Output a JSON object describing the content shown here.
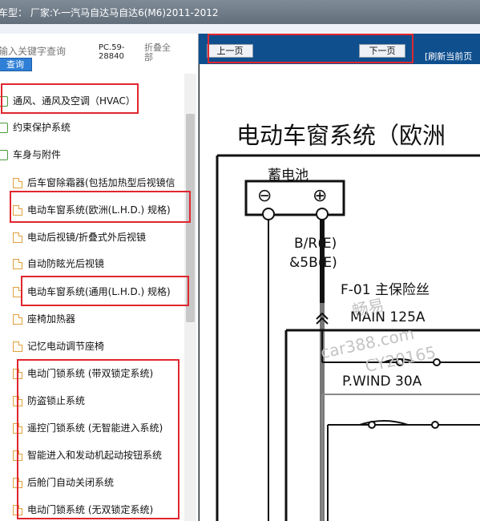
{
  "window": {
    "title": "车型：  厂家:Y-一汽马自达马自达6(M6)2011-2012"
  },
  "search": {
    "placeholder": "输入关键字查询",
    "button": "查询"
  },
  "pc_info": "PC.59-28840",
  "collapse_all": "折叠全部",
  "tree": [
    {
      "label": "通风、通风及空调（HVAC）",
      "type": "folder"
    },
    {
      "label": "约束保护系统",
      "type": "folder"
    },
    {
      "label": "车身与附件",
      "type": "folder"
    },
    {
      "label": "后车窗除霜器(包括加热型后视镜信",
      "type": "page"
    },
    {
      "label": "电动车窗系统(欧洲(L.H.D.) 规格)",
      "type": "page"
    },
    {
      "label": "电动后视镜/折叠式外后视镜",
      "type": "page"
    },
    {
      "label": "自动防眩光后视镜",
      "type": "page"
    },
    {
      "label": "电动车窗系统(通用(L.H.D.) 规格)",
      "type": "page"
    },
    {
      "label": "座椅加热器",
      "type": "page"
    },
    {
      "label": "记忆电动调节座椅",
      "type": "page"
    },
    {
      "label": "电动门锁系统 (带双锁定系统)",
      "type": "page"
    },
    {
      "label": "防盗锁止系统",
      "type": "page"
    },
    {
      "label": "遥控门锁系统 (无智能进入系统)",
      "type": "page"
    },
    {
      "label": "智能进入和发动机起动按钮系统",
      "type": "page"
    },
    {
      "label": "后舱门自动关闭系统",
      "type": "page"
    },
    {
      "label": "电动门锁系统 (无双锁定系统)",
      "type": "page"
    }
  ],
  "viewer": {
    "prev": "上一页",
    "next": "下一页",
    "refresh": "[刷新当前页"
  },
  "diagram": {
    "title": "电动车窗系统（欧洲",
    "battery": "蓄电池",
    "minus": "⊖",
    "plus": "⊕",
    "wire": "B/R(E)",
    "wire2": "&5B(E)",
    "fuse_box": "F-01 主保险丝",
    "main_fuse": "MAIN 125A",
    "pwind_fuse": "P.WIND 30A"
  },
  "watermark": {
    "line1": "畅易",
    "line2": "car388.com",
    "line3": "CY20165"
  }
}
